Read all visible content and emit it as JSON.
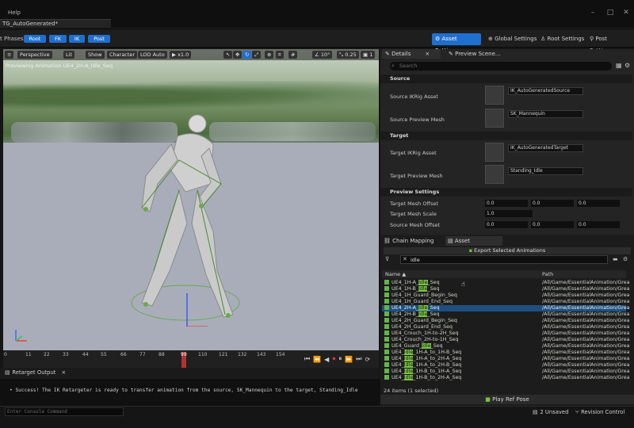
{
  "window": {
    "menu": "Help",
    "doc_tab": "TG_AutoGenerated*"
  },
  "toolbar": {
    "phases_label": "t Phases:",
    "phases": [
      "Root",
      "FK",
      "IK",
      "Post"
    ],
    "buttons": [
      "Asset Settings",
      "Global Settings",
      "Root Settings",
      "Post Settings"
    ]
  },
  "viewport": {
    "menu_icon": "hamburger-icon",
    "perspective": "Perspective",
    "lit": "Lit",
    "show": "Show",
    "character": "Character",
    "lod": "LOD Auto",
    "speed": "x1.0",
    "snap_angle": "10°",
    "scale": "0.25",
    "cam_speed": "1",
    "preview_label": "Previewing Animation UE4_2H-A_Idle_Seq"
  },
  "timeline": {
    "ticks": [
      "0",
      "11",
      "22",
      "33",
      "44",
      "55",
      "66",
      "77",
      "88",
      "99",
      "110",
      "121",
      "132",
      "143",
      "154"
    ],
    "scrub_value": "99"
  },
  "output": {
    "tab": "Retarget Output",
    "message": "• Success! The IK Retargeter is ready to transfer animation from the source, SK_Mannequin to the target, Standing_Idle",
    "cmd_placeholder": "Enter Console Command"
  },
  "details": {
    "tab": "Details",
    "tab2": "Preview Scene...",
    "search_placeholder": "Search",
    "source_header": "Source",
    "source_ikrig_label": "Source IKRig Asset",
    "source_ikrig_value": "IK_AutoGeneratedSource",
    "source_mesh_label": "Source Preview Mesh",
    "source_mesh_value": "SK_Mannequin",
    "target_header": "Target",
    "target_ikrig_label": "Target IKRig Asset",
    "target_ikrig_value": "IK_AutoGeneratedTarget",
    "target_mesh_label": "Target Preview Mesh",
    "target_mesh_value": "Standing_Idle",
    "preview_header": "Preview Settings",
    "tmo_label": "Target Mesh Offset",
    "tms_label": "Target Mesh Scale",
    "smo_label": "Source Mesh Offset",
    "tmo": [
      "0.0",
      "0.0",
      "0.0"
    ],
    "tms": "1.0",
    "smo": [
      "0.0",
      "0.0",
      "0.0"
    ]
  },
  "browser": {
    "tab1": "Chain Mapping",
    "tab2": "Asset Browser",
    "export": "Export Selected Animations",
    "filter": "idle",
    "col_name": "Name",
    "col_path": "Path",
    "rows": [
      {
        "pre": "UE4_1H-A_",
        "hl": "Idle",
        "post": "_Seq",
        "path": "/All/Game/EssentialAnimation/Grea"
      },
      {
        "pre": "UE4_1H-B_",
        "hl": "Idle",
        "post": "_Seq",
        "path": "/All/Game/EssentialAnimation/Grea"
      },
      {
        "pre": "UE4_1H_Guard_Begin_Seq",
        "hl": "",
        "post": "",
        "path": "/All/Game/EssentialAnimation/Grea"
      },
      {
        "pre": "UE4_1H_Guard_End_Seq",
        "hl": "",
        "post": "",
        "path": "/All/Game/EssentialAnimation/Grea"
      },
      {
        "pre": "UE4_2H-A_",
        "hl": "Idle",
        "post": "_Seq",
        "path": "/All/Game/EssentialAnimation/Grea"
      },
      {
        "pre": "UE4_2H-B_",
        "hl": "Idle",
        "post": "_Seq",
        "path": "/All/Game/EssentialAnimation/Grea"
      },
      {
        "pre": "UE4_2H_Guard_Begin_Seq",
        "hl": "",
        "post": "",
        "path": "/All/Game/EssentialAnimation/Grea"
      },
      {
        "pre": "UE4_2H_Guard_End_Seq",
        "hl": "",
        "post": "",
        "path": "/All/Game/EssentialAnimation/Grea"
      },
      {
        "pre": "UE4_Crouch_1H-to-2H_Seq",
        "hl": "",
        "post": "",
        "path": "/All/Game/EssentialAnimation/Grea"
      },
      {
        "pre": "UE4_Crouch_2H-to-1H_Seq",
        "hl": "",
        "post": "",
        "path": "/All/Game/EssentialAnimation/Grea"
      },
      {
        "pre": "UE4_Guard_",
        "hl": "Idle",
        "post": "_Seq",
        "path": "/All/Game/EssentialAnimation/Grea"
      },
      {
        "pre": "UE4_",
        "hl": "Idle",
        "post": "_1H-A_to_1H-B_Seq",
        "path": "/All/Game/EssentialAnimation/Grea"
      },
      {
        "pre": "UE4_",
        "hl": "Idle",
        "post": "_1H-A_to_2H-A_Seq",
        "path": "/All/Game/EssentialAnimation/Grea"
      },
      {
        "pre": "UE4_",
        "hl": "Idle",
        "post": "_1H-A_to_2H-B_Seq",
        "path": "/All/Game/EssentialAnimation/Grea"
      },
      {
        "pre": "UE4_",
        "hl": "Idle",
        "post": "_1H-B_to_1H-A_Seq",
        "path": "/All/Game/EssentialAnimation/Grea"
      },
      {
        "pre": "UE4_",
        "hl": "Idle",
        "post": "_1H-B_to_2H-A_Seq",
        "path": "/All/Game/EssentialAnimation/Grea"
      }
    ],
    "count": "24 items (1 selected)",
    "play_ref": "Play Ref Pose"
  },
  "status": {
    "unsaved": "2 Unsaved",
    "revision": "Revision Control"
  },
  "colors": {
    "accent": "#1f6fd1",
    "highlight": "#7bc043",
    "selection": "#1f4f7e"
  }
}
